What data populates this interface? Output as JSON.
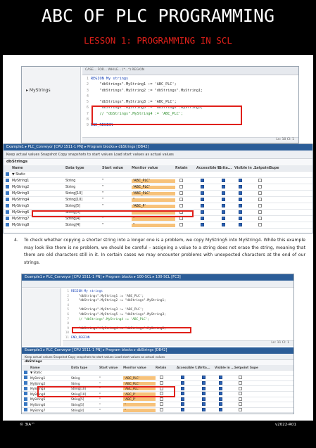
{
  "header": {
    "title": "ABC OF PLC PROGRAMMING",
    "subtitle": "LESSON 1: PROGRAMMING  IN SCL"
  },
  "top_shot": {
    "tree_item": "MyStrings",
    "toolbar": "CASE...  FOR...  WHILE...  (*...*)  REGION",
    "code": [
      {
        "n": "1",
        "t": "REGION My strings",
        "cls": "kw"
      },
      {
        "n": "2",
        "t": "    \"dbStrings\".MyString1 := 'ABC_PLC';",
        "cls": ""
      },
      {
        "n": "3",
        "t": "    \"dbStrings\".MyString2 := \"dbStrings\".MyString1;",
        "cls": ""
      },
      {
        "n": "4",
        "t": "",
        "cls": ""
      },
      {
        "n": "5",
        "t": "    \"dbStrings\".MyString3 := 'ABC_PLC';",
        "cls": ""
      },
      {
        "n": "6",
        "t": "    \"dbStrings\".MyString5 := \"dbStrings\".MyString3;",
        "cls": ""
      },
      {
        "n": "7",
        "t": "    // \"dbStrings\".MyString4 := 'ABC_PLC';",
        "cls": "cm"
      },
      {
        "n": "8",
        "t": "",
        "cls": ""
      },
      {
        "n": "9",
        "t": "END_REGION",
        "cls": "kw"
      }
    ],
    "status": "Ln: 10    Cl: 1"
  },
  "db_shot": {
    "breadcrumb": "Example1 ▸ PLC_Conveyor [CPU 1511-1 PN] ▸ Program blocks ▸ dbStrings [DB42]",
    "toolbar": "Keep actual values    Snapshot    Copy snapshots to start values    Load start values as actual values",
    "db_name": "dbStrings",
    "columns": [
      "",
      "Name",
      "Data type",
      "Start value",
      "Monitor value",
      "Retain",
      "Accessible f...",
      "Writa...",
      "Visible in ...",
      "Setpoint",
      "Supe"
    ],
    "rows": [
      {
        "name": "▼ Static",
        "type": "",
        "start": "",
        "mon": ""
      },
      {
        "name": "MyString1",
        "type": "String",
        "start": "''",
        "mon": "'ABC_PLC'"
      },
      {
        "name": "MyString2",
        "type": "String",
        "start": "''",
        "mon": "'ABC_PLC'"
      },
      {
        "name": "MyString3",
        "type": "String[10]",
        "start": "''",
        "mon": "'ABC_PLC'"
      },
      {
        "name": "MyString4",
        "type": "String[10]",
        "start": "''",
        "mon": "''"
      },
      {
        "name": "MyString5",
        "type": "String[5]",
        "start": "''",
        "mon": "'ABC_P'"
      },
      {
        "name": "MyString6",
        "type": "String[5]",
        "start": "''",
        "mon": "''"
      },
      {
        "name": "MyString7",
        "type": "String[4]",
        "start": "''",
        "mon": "''"
      },
      {
        "name": "MyString8",
        "type": "String[4]",
        "start": "''",
        "mon": "''"
      }
    ]
  },
  "paragraph": {
    "number": "4.",
    "text": "To check whether copying a shorter string into a longer one is a problem, we copy MyString5 into MyString4. While this example may look like there is no problem, we should be careful – assigning a value to a string does not erase the string, meaning that there are old characters still in it. In certain cases we may encounter problems with unexpected characters at the end of our strings."
  },
  "bottom_shot": {
    "breadcrumb": "Example1 ▸ PLC_Conveyor [CPU 1511-1 PN] ▸ Program blocks ▸ 100-SCL ▸ 100-SCL [FC3]",
    "code": [
      {
        "n": "1",
        "t": "REGION My strings",
        "cls": "kw"
      },
      {
        "n": "2",
        "t": "    \"dbStrings\".MyString1 := 'ABC_PLC';",
        "cls": ""
      },
      {
        "n": "3",
        "t": "    \"dbStrings\".MyString2 := \"dbStrings\".MyString1;",
        "cls": ""
      },
      {
        "n": "4",
        "t": "",
        "cls": ""
      },
      {
        "n": "5",
        "t": "    \"dbStrings\".MyString3 := 'ABC_PLC';",
        "cls": ""
      },
      {
        "n": "6",
        "t": "    \"dbStrings\".MyString5 := \"dbStrings\".MyString3;",
        "cls": ""
      },
      {
        "n": "7",
        "t": "    // \"dbStrings\".MyString4 := 'ABC_PLC';",
        "cls": "cm"
      },
      {
        "n": "8",
        "t": "",
        "cls": ""
      },
      {
        "n": "9",
        "t": "    \"dbStrings\".MyString4 := \"dbStrings\".MyString5;",
        "cls": ""
      },
      {
        "n": "10",
        "t": "",
        "cls": ""
      },
      {
        "n": "11",
        "t": "END_REGION",
        "cls": "kw"
      }
    ],
    "status": "Ln: 11    Cl: 1",
    "breadcrumb2": "Example1 ▸ PLC_Conveyor [CPU 1511-1 PN] ▸ Program blocks ▸ dbStrings [DB42]",
    "rows": [
      {
        "name": "▼ Static",
        "type": "",
        "start": "",
        "mon": ""
      },
      {
        "name": "MyString1",
        "type": "String",
        "start": "''",
        "mon": "'ABC_PLC'"
      },
      {
        "name": "MyString2",
        "type": "String",
        "start": "''",
        "mon": "'ABC_PLC'"
      },
      {
        "name": "MyString3",
        "type": "String[10]",
        "start": "''",
        "mon": "'ABC_PLC'"
      },
      {
        "name": "MyString4",
        "type": "String[10]",
        "start": "''",
        "mon": "'ABC_P'"
      },
      {
        "name": "MyString5",
        "type": "String[5]",
        "start": "''",
        "mon": "'ABC_P'"
      },
      {
        "name": "MyString6",
        "type": "String[5]",
        "start": "''",
        "mon": "''"
      },
      {
        "name": "MyString7",
        "type": "String[4]",
        "start": "''",
        "mon": "''"
      },
      {
        "name": "MyString8",
        "type": "String[4]",
        "start": "''",
        "mon": "''"
      }
    ]
  },
  "footer": {
    "left": "© 3IA™",
    "right": "v2022-R01"
  }
}
